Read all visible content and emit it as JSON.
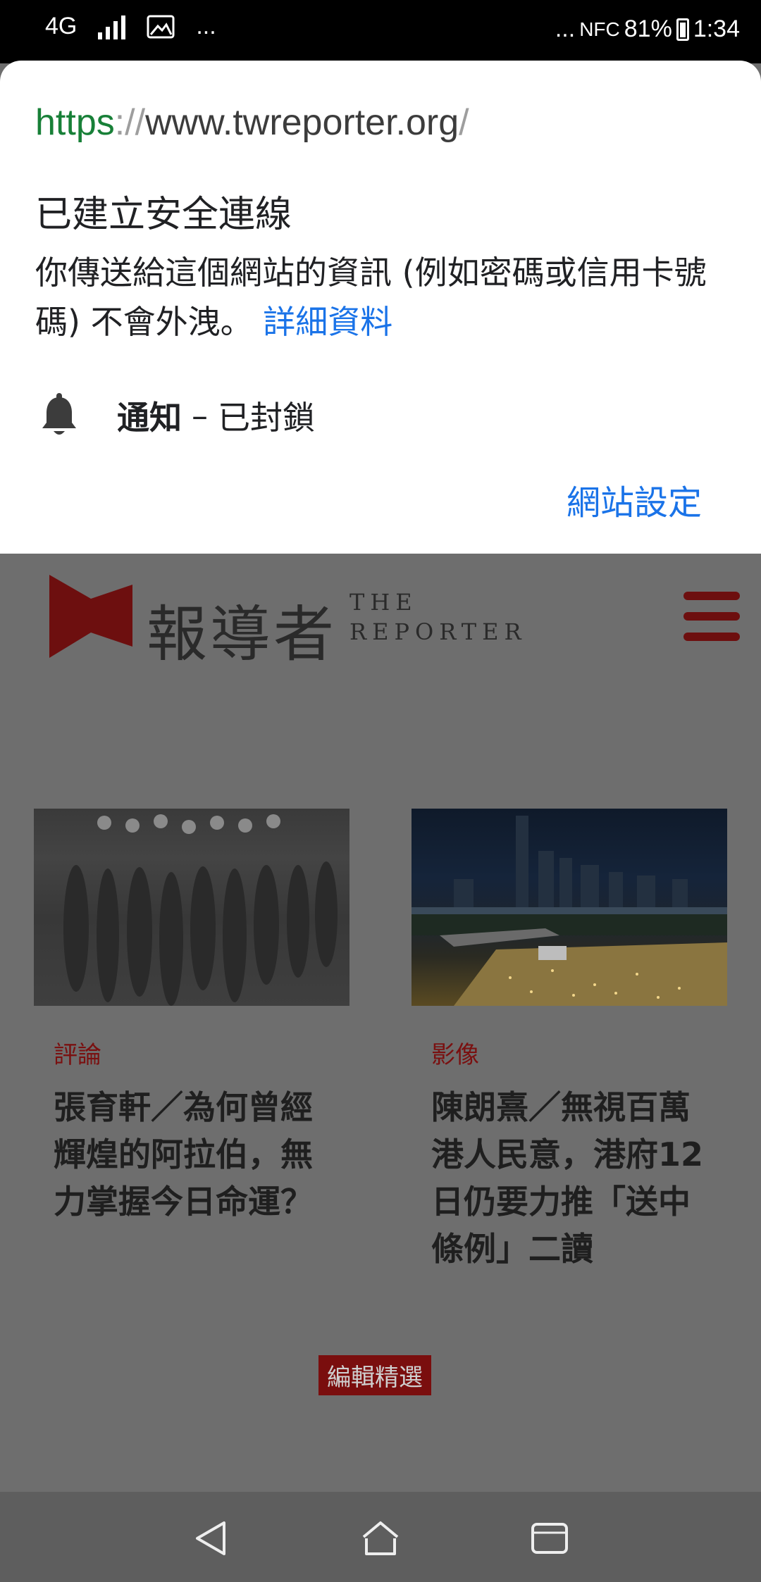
{
  "status_bar": {
    "network": "4G",
    "overflow_left": "...",
    "overflow_right": "...",
    "nfc": "NFC",
    "battery": "81%",
    "time": "1:34"
  },
  "security_sheet": {
    "url_scheme": "https",
    "url_sep": "://",
    "url_host": "www.twreporter.org",
    "url_trailing": "/",
    "title": "已建立安全連線",
    "description": "你傳送給這個網站的資訊 (例如密碼或信用卡號碼) 不會外洩。",
    "details_link": "詳細資料",
    "notification_label": "通知",
    "notification_dash": "–",
    "notification_state": "已封鎖",
    "site_settings": "網站設定"
  },
  "site": {
    "logo_zh": "報導者",
    "logo_en_line1": "THE",
    "logo_en_line2": "REPORTER",
    "cards": [
      {
        "category": "評論",
        "headline": "張育軒／為何曾經輝煌的阿拉伯，無力掌握今日命運？"
      },
      {
        "category": "影像",
        "headline": "陳朗熹／無視百萬港人民意，港府12日仍要力推「送中條例」二讀"
      }
    ],
    "editor_tag": "編輯精選",
    "brand_color": "#8b1515"
  }
}
